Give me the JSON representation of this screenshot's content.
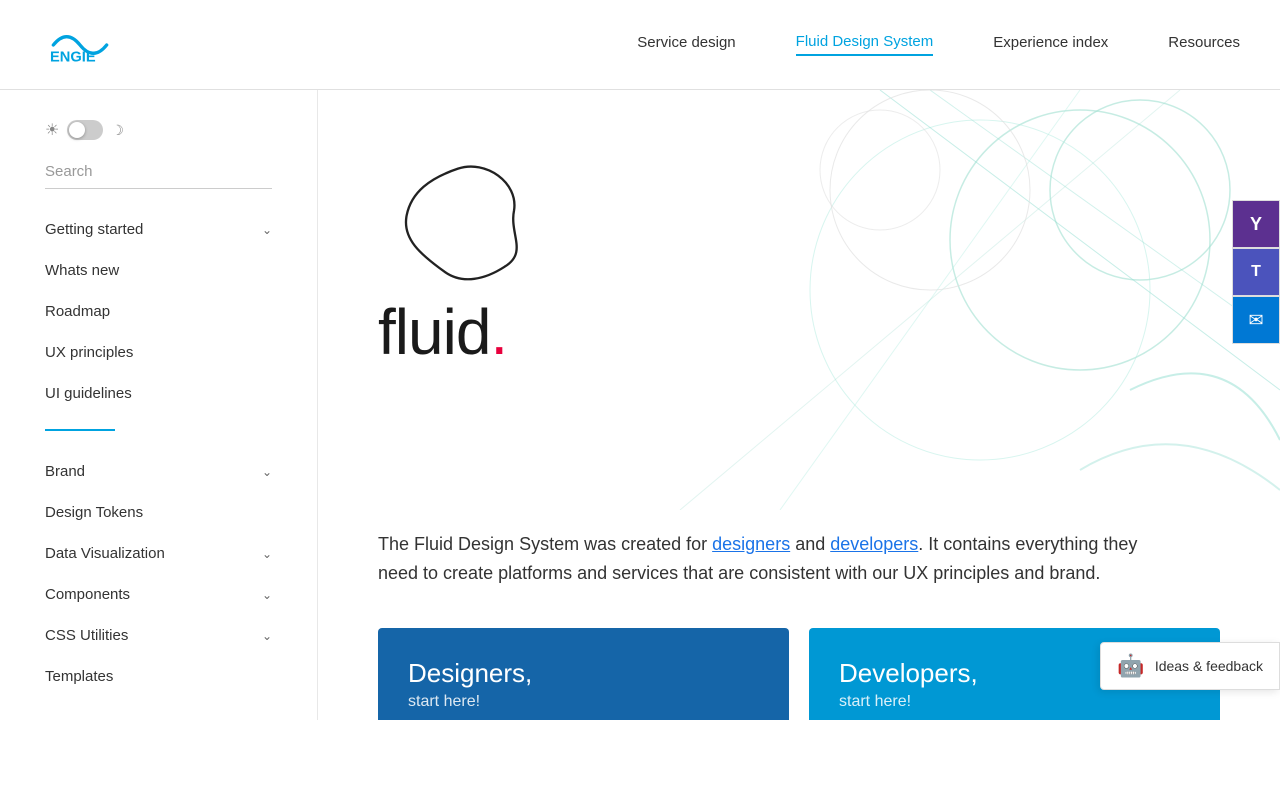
{
  "header": {
    "logo_alt": "ENGIE logo",
    "nav_items": [
      {
        "id": "service-design",
        "label": "Service design",
        "active": false
      },
      {
        "id": "fluid-design-system",
        "label": "Fluid Design System",
        "active": true
      },
      {
        "id": "experience-index",
        "label": "Experience index",
        "active": false
      },
      {
        "id": "resources",
        "label": "Resources",
        "active": false
      }
    ]
  },
  "sidebar": {
    "search_placeholder": "Search",
    "theme_toggle": {
      "sun_symbol": "☀",
      "moon_symbol": "☽"
    },
    "top_nav": [
      {
        "id": "getting-started",
        "label": "Getting started",
        "has_chevron": true
      },
      {
        "id": "whats-new",
        "label": "Whats new",
        "has_chevron": false
      },
      {
        "id": "roadmap",
        "label": "Roadmap",
        "has_chevron": false
      },
      {
        "id": "ux-principles",
        "label": "UX principles",
        "has_chevron": false
      },
      {
        "id": "ui-guidelines",
        "label": "UI guidelines",
        "has_chevron": false
      }
    ],
    "bottom_nav": [
      {
        "id": "brand",
        "label": "Brand",
        "has_chevron": true
      },
      {
        "id": "design-tokens",
        "label": "Design Tokens",
        "has_chevron": false
      },
      {
        "id": "data-visualization",
        "label": "Data Visualization",
        "has_chevron": true
      },
      {
        "id": "components",
        "label": "Components",
        "has_chevron": true
      },
      {
        "id": "css-utilities",
        "label": "CSS Utilities",
        "has_chevron": true
      },
      {
        "id": "templates",
        "label": "Templates",
        "has_chevron": false
      }
    ]
  },
  "main": {
    "fluid_title": "fluid",
    "fluid_dot": ".",
    "description": "The Fluid Design System was created for ",
    "description_link1": "designers",
    "description_mid": " and ",
    "description_link2": "developers",
    "description_end": ". It contains everything they need to create platforms and services that are consistent with our UX principles and brand.",
    "cards": [
      {
        "id": "designers",
        "title": "Designers,",
        "subtitle": "start here!"
      },
      {
        "id": "developers",
        "title": "Developers,",
        "subtitle": "start here!"
      }
    ],
    "feedback_label": "Ideas & feedback"
  },
  "floating_buttons": [
    {
      "id": "yammer",
      "symbol": "Y",
      "color": "#5C3090"
    },
    {
      "id": "teams",
      "symbol": "T",
      "color": "#4B53BC"
    },
    {
      "id": "mail",
      "symbol": "✉",
      "color": "#0078D4"
    }
  ]
}
